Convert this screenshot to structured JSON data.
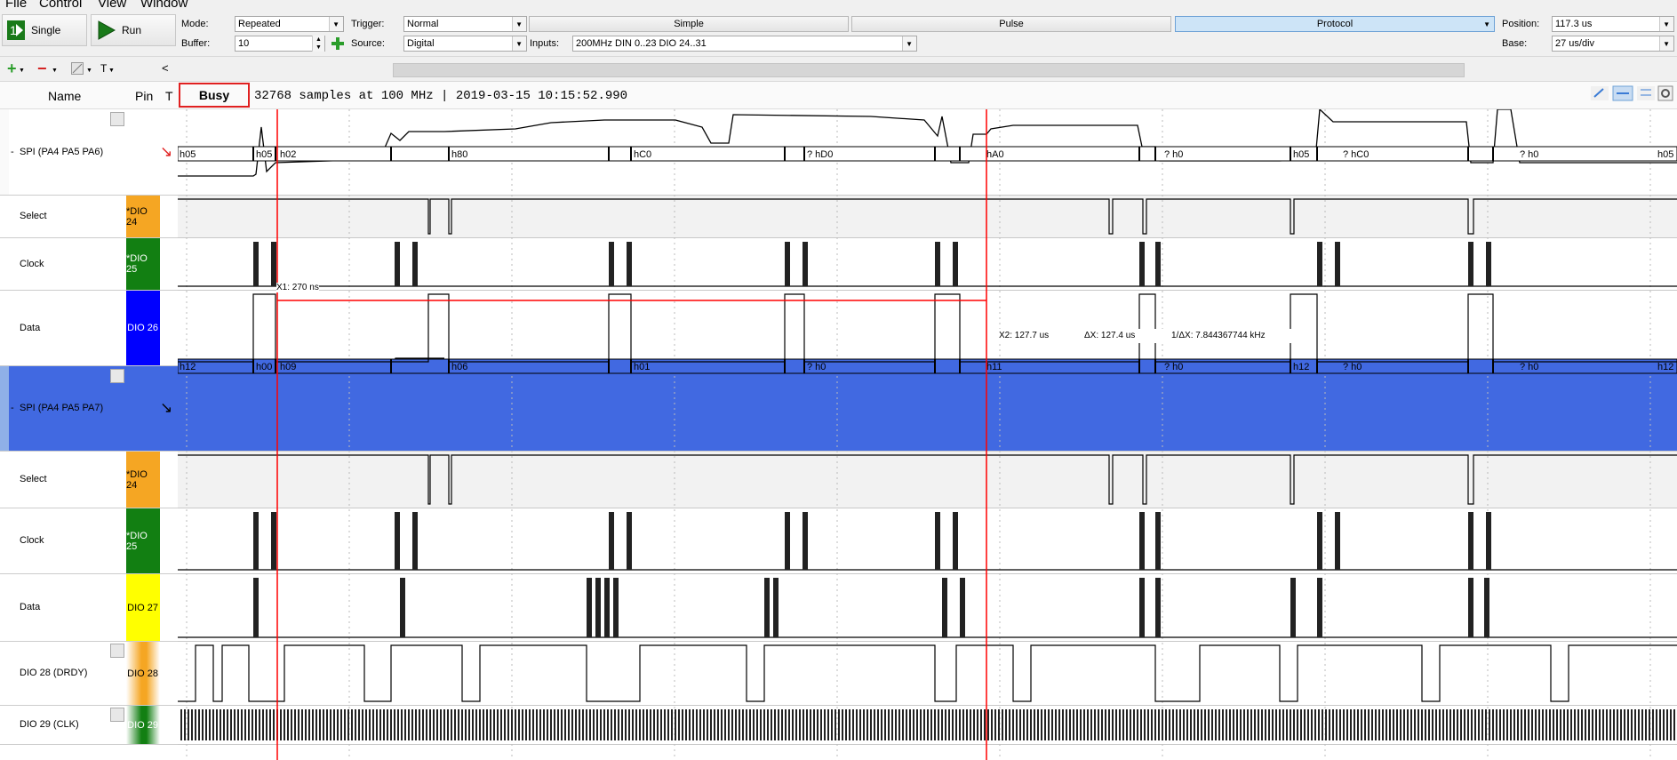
{
  "menu": {
    "file": "File",
    "control": "Control",
    "view": "View",
    "window": "Window"
  },
  "toolbar": {
    "single_label": "Single",
    "run_label": "Run",
    "mode_label": "Mode:",
    "mode_value": "Repeated",
    "buffer_label": "Buffer:",
    "buffer_value": "10",
    "trigger_label": "Trigger:",
    "trigger_value": "Normal",
    "source_label": "Source:",
    "source_value": "Digital",
    "inputs_label": "Inputs:",
    "inputs_value": "200MHz DIN 0..23 DIO 24..31",
    "tab_simple": "Simple",
    "tab_pulse": "Pulse",
    "tab_protocol": "Protocol",
    "position_label": "Position:",
    "position_value": "117.3 us",
    "base_label": "Base:",
    "base_value": "27 us/div"
  },
  "toolbar2": {
    "add_glyph": "+",
    "remove_glyph": "−",
    "t_label": "T",
    "collapse_glyph": "<"
  },
  "header": {
    "name_col": "Name",
    "pin_col": "Pin",
    "t_col": "T",
    "status_label": "Busy",
    "info": "32768 samples at 100 MHz | 2019-03-15 10:15:52.990"
  },
  "channels": [
    {
      "name": "SPI (PA4 PA5 PA6)",
      "pin": "",
      "prefix": "-"
    },
    {
      "name": "Select",
      "pin": "*DIO 24",
      "pin_color": "#f5a623"
    },
    {
      "name": "Clock",
      "pin": "*DIO 25",
      "pin_color": "#127f12"
    },
    {
      "name": "Data",
      "pin": "DIO 26",
      "pin_color": "#0000ff"
    },
    {
      "name": "SPI (PA4 PA5 PA7)",
      "pin": "",
      "prefix": "-"
    },
    {
      "name": "Select",
      "pin": "*DIO 24",
      "pin_color": "#f5a623"
    },
    {
      "name": "Clock",
      "pin": "*DIO 25",
      "pin_color": "#127f12"
    },
    {
      "name": "Data",
      "pin": "DIO 27",
      "pin_color": "#ffff00"
    },
    {
      "name": "DIO 28 (DRDY)",
      "pin": "DIO 28",
      "pin_color": "#f5a623"
    },
    {
      "name": "DIO 29 (CLK)",
      "pin": "DIO 29",
      "pin_color": "#127f12"
    }
  ],
  "spi1_labels": [
    "h05",
    "h05",
    "h02",
    "h80",
    "hC0",
    "? hD0",
    "hA0",
    "? h0",
    "h05",
    "? hC0",
    "? h0",
    "h05"
  ],
  "spi2_labels": [
    "h12",
    "h00",
    "h09",
    "h06",
    "h01",
    "? h0",
    "h11",
    "? h0",
    "h12",
    "? h0",
    "? h0",
    "h12"
  ],
  "cursors": {
    "x1": "X1: 270 ns",
    "x2": "X2: 127.7 us",
    "dx": "ΔX: 127.4 us",
    "inv_dx": "1/ΔX: 7.844367744 kHz"
  },
  "colors": {
    "cursor": "#ff0000",
    "selected_row": "#4169e1",
    "accent_tab": "#cde4f7"
  }
}
